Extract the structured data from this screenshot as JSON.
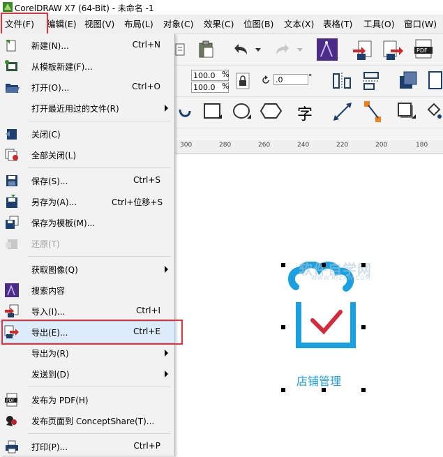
{
  "window": {
    "title": "CorelDRAW X7 (64-Bit) - 未命名 -1"
  },
  "menubar": [
    {
      "label": "文件(F)",
      "active": true
    },
    {
      "label": "编辑(E)"
    },
    {
      "label": "视图(V)"
    },
    {
      "label": "布局(L)"
    },
    {
      "label": "对象(C)"
    },
    {
      "label": "效果(C)"
    },
    {
      "label": "位图(B)"
    },
    {
      "label": "文本(X)"
    },
    {
      "label": "表格(T)"
    },
    {
      "label": "工具(O)"
    },
    {
      "label": "窗口(W)"
    }
  ],
  "file_menu": {
    "items": [
      {
        "label": "新建(N)...",
        "shortcut": "Ctrl+N",
        "icon": "new-document-icon"
      },
      {
        "label": "从模板新建(F)...",
        "shortcut": "",
        "icon": "new-from-template-icon"
      },
      {
        "label": "打开(O)...",
        "shortcut": "Ctrl+O",
        "icon": "open-folder-icon"
      },
      {
        "label": "打开最近用过的文件(R)",
        "shortcut": "",
        "submenu": true
      },
      {
        "label": "关闭(C)",
        "shortcut": "",
        "icon": "close-document-icon"
      },
      {
        "label": "全部关闭(L)",
        "shortcut": "",
        "icon": "close-all-icon"
      },
      {
        "label": "保存(S)...",
        "shortcut": "Ctrl+S",
        "icon": "save-icon"
      },
      {
        "label": "另存为(A)...",
        "shortcut": "Ctrl+位移+S",
        "icon": "save-as-icon"
      },
      {
        "label": "保存为模板(M)...",
        "shortcut": "",
        "icon": "save-template-icon"
      },
      {
        "label": "还原(T)",
        "shortcut": "",
        "icon": "revert-icon",
        "disabled": true
      },
      {
        "label": "获取图像(Q)",
        "shortcut": "",
        "submenu": true
      },
      {
        "label": "搜索内容",
        "shortcut": "",
        "icon": "search-content-icon"
      },
      {
        "label": "导入(I)...",
        "shortcut": "Ctrl+I",
        "icon": "import-icon"
      },
      {
        "label": "导出(E)...",
        "shortcut": "Ctrl+E",
        "icon": "export-icon",
        "highlighted": true
      },
      {
        "label": "导出为(R)",
        "shortcut": "",
        "submenu": true
      },
      {
        "label": "发送到(D)",
        "shortcut": "",
        "submenu": true
      },
      {
        "label": "发布为 PDF(H)",
        "shortcut": "",
        "icon": "pdf-icon"
      },
      {
        "label": "发布页面到 ConceptShare(T)...",
        "shortcut": "",
        "icon": "conceptshare-icon"
      },
      {
        "label": "打印(P)...",
        "shortcut": "Ctrl+P",
        "icon": "print-icon"
      }
    ]
  },
  "property_bar": {
    "scale_x": "100.0",
    "scale_y": "100.0",
    "percent": "%",
    "angle": ".0",
    "degree": "°"
  },
  "ruler": {
    "ticks": [
      "300",
      "280",
      "260",
      "240",
      "220",
      "200",
      "180"
    ]
  },
  "canvas": {
    "label": "店铺管理",
    "watermark": "软件自学网",
    "watermark_url": "WWW.RJZXW.COM"
  },
  "colors": {
    "accent_blue": "#1aa0e0",
    "check_red": "#d42a3c",
    "highlight_red_box": "#e3343a",
    "menu_highlight": "#dcecfb"
  }
}
